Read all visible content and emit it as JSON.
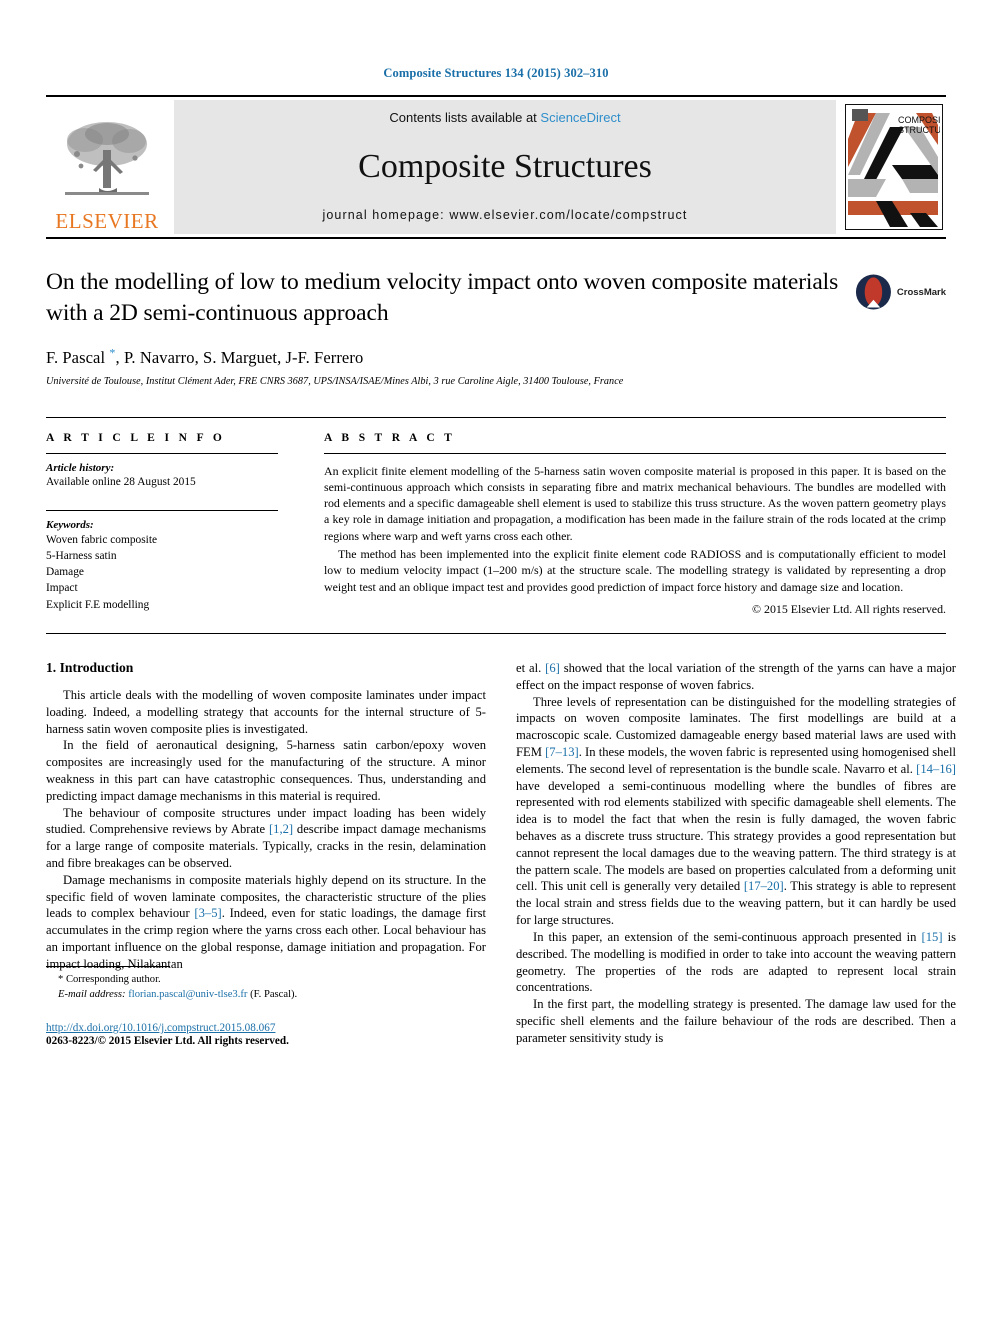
{
  "running_head": "Composite Structures 134 (2015) 302–310",
  "masthead": {
    "publisher_logo_text": "ELSEVIER",
    "contents_prefix": "Contents lists available at ",
    "sciencedirect": "ScienceDirect",
    "journal_name": "Composite Structures",
    "homepage": "journal homepage: www.elsevier.com/locate/compstruct",
    "cover_line1": "COMPOSITE",
    "cover_line2": "STRUCTURES",
    "accent_orange": "#E87722",
    "link_blue": "#2e8ecb"
  },
  "title_block": {
    "title": "On the modelling of low to medium velocity impact onto woven composite materials with a 2D semi-continuous approach",
    "authors": "F. Pascal , P. Navarro, S. Marguet, J-F. Ferrero",
    "corresponding_marker": "*",
    "affiliation": "Université de Toulouse, Institut Clément Ader, FRE CNRS 3687, UPS/INSA/ISAE/Mines Albi, 3 rue Caroline Aigle, 31400 Toulouse, France",
    "crossmark_label": "CrossMark"
  },
  "article_info": {
    "heading": "A R T I C L E  I N F O",
    "history_label": "Article history:",
    "history_value": "Available online 28 August 2015",
    "keywords_label": "Keywords:",
    "keywords": [
      "Woven fabric composite",
      "5-Harness satin",
      "Damage",
      "Impact",
      "Explicit F.E modelling"
    ]
  },
  "abstract": {
    "heading": "A B S T R A C T",
    "paragraphs": [
      "An explicit finite element modelling of the 5-harness satin woven composite material is proposed in this paper. It is based on the semi-continuous approach which consists in separating fibre and matrix mechanical behaviours. The bundles are modelled with rod elements and a specific damageable shell element is used to stabilize this truss structure. As the woven pattern geometry plays a key role in damage initiation and propagation, a modification has been made in the failure strain of the rods located at the crimp regions where warp and weft yarns cross each other.",
      "The method has been implemented into the explicit finite element code RADIOSS and is computationally efficient to model low to medium velocity impact (1–200 m/s) at the structure scale. The modelling strategy is validated by representing a drop weight test and an oblique impact test and provides good prediction of impact force history and damage size and location."
    ],
    "copyright": "© 2015 Elsevier Ltd. All rights reserved."
  },
  "body": {
    "section_title": "1. Introduction",
    "left_paragraphs": [
      "This article deals with the modelling of woven composite laminates under impact loading. Indeed, a modelling strategy that accounts for the internal structure of 5-harness satin woven composite plies is investigated.",
      "In the field of aeronautical designing, 5-harness satin carbon/epoxy woven composites are increasingly used for the manufacturing of the structure. A minor weakness in this part can have catastrophic consequences. Thus, understanding and predicting impact damage mechanisms in this material is required.",
      "The behaviour of composite structures under impact loading has been widely studied. Comprehensive reviews by Abrate [1,2] describe impact damage mechanisms for a large range of composite materials. Typically, cracks in the resin, delamination and fibre breakages can be observed.",
      "Damage mechanisms in composite materials highly depend on its structure. In the specific field of woven laminate composites, the characteristic structure of the plies leads to complex behaviour [3–5]. Indeed, even for static loadings, the damage first accumulates in the crimp region where the yarns cross each other. Local behaviour has an important influence on the global response, damage initiation and propagation. For impact loading, Nilakantan"
    ],
    "right_paragraphs": [
      "et al. [6] showed that the local variation of the strength of the yarns can have a major effect on the impact response of woven fabrics.",
      "Three levels of representation can be distinguished for the modelling strategies of impacts on woven composite laminates. The first modellings are build at a macroscopic scale. Customized damageable energy based material laws are used with FEM [7–13]. In these models, the woven fabric is represented using homogenised shell elements. The second level of representation is the bundle scale. Navarro et al. [14–16] have developed a semi-continuous modelling where the bundles of fibres are represented with rod elements stabilized with specific damageable shell elements. The idea is to model the fact that when the resin is fully damaged, the woven fabric behaves as a discrete truss structure. This strategy provides a good representation but cannot represent the local damages due to the weaving pattern. The third strategy is at the pattern scale. The models are based on properties calculated from a deforming unit cell. This unit cell is generally very detailed [17–20]. This strategy is able to represent the local strain and stress fields due to the weaving pattern, but it can hardly be used for large structures.",
      "In this paper, an extension of the semi-continuous approach presented in [15] is described. The modelling is modified in order to take into account the weaving pattern geometry. The properties of the rods are adapted to represent local strain concentrations.",
      "In the first part, the modelling strategy is presented. The damage law used for the specific shell elements and the failure behaviour of the rods are described. Then a parameter sensitivity study is"
    ],
    "citations": [
      "[1,2]",
      "[3–5]",
      "[6]",
      "[7–13]",
      "[14–16]",
      "[17–20]",
      "[15]"
    ]
  },
  "footnotes": {
    "corresponding": "* Corresponding author.",
    "email_label": "E-mail address:",
    "email": "florian.pascal@univ-tlse3.fr",
    "email_suffix": "(F. Pascal).",
    "doi": "http://dx.doi.org/10.1016/j.compstruct.2015.08.067",
    "issn": "0263-8223/© 2015 Elsevier Ltd. All rights reserved."
  }
}
